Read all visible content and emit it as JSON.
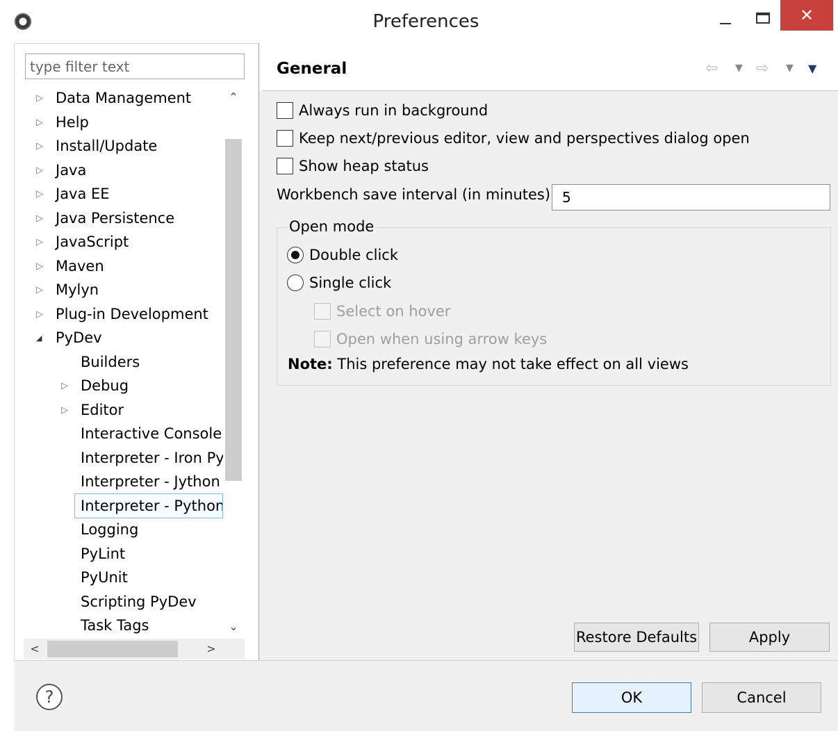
{
  "window": {
    "title": "Preferences",
    "close_glyph": "✕"
  },
  "sidebar": {
    "filter_placeholder": "type filter text",
    "items": [
      {
        "label": "Data Management",
        "level": 0,
        "twisty": "collapsed"
      },
      {
        "label": "Help",
        "level": 0,
        "twisty": "collapsed"
      },
      {
        "label": "Install/Update",
        "level": 0,
        "twisty": "collapsed"
      },
      {
        "label": "Java",
        "level": 0,
        "twisty": "collapsed"
      },
      {
        "label": "Java EE",
        "level": 0,
        "twisty": "collapsed"
      },
      {
        "label": "Java Persistence",
        "level": 0,
        "twisty": "collapsed"
      },
      {
        "label": "JavaScript",
        "level": 0,
        "twisty": "collapsed"
      },
      {
        "label": "Maven",
        "level": 0,
        "twisty": "collapsed"
      },
      {
        "label": "Mylyn",
        "level": 0,
        "twisty": "collapsed"
      },
      {
        "label": "Plug-in Development",
        "level": 0,
        "twisty": "collapsed"
      },
      {
        "label": "PyDev",
        "level": 0,
        "twisty": "expanded"
      },
      {
        "label": "Builders",
        "level": 1,
        "twisty": "none"
      },
      {
        "label": "Debug",
        "level": 1,
        "twisty": "collapsed"
      },
      {
        "label": "Editor",
        "level": 1,
        "twisty": "collapsed"
      },
      {
        "label": "Interactive Console",
        "level": 1,
        "twisty": "none"
      },
      {
        "label": "Interpreter - Iron Pyt",
        "level": 1,
        "twisty": "none"
      },
      {
        "label": "Interpreter - Jython",
        "level": 1,
        "twisty": "none"
      },
      {
        "label": "Interpreter - Python",
        "level": 1,
        "twisty": "none",
        "selected": true
      },
      {
        "label": "Logging",
        "level": 1,
        "twisty": "none"
      },
      {
        "label": "PyLint",
        "level": 1,
        "twisty": "none"
      },
      {
        "label": "PyUnit",
        "level": 1,
        "twisty": "none"
      },
      {
        "label": "Scripting PyDev",
        "level": 1,
        "twisty": "none"
      },
      {
        "label": "Task Tags",
        "level": 1,
        "twisty": "none"
      }
    ]
  },
  "page": {
    "title": "General",
    "options": [
      {
        "label": "Always run in background",
        "checked": false
      },
      {
        "label": "Keep next/previous editor, view and perspectives dialog open",
        "checked": false
      },
      {
        "label": "Show heap status",
        "checked": false
      }
    ],
    "interval_label": "Workbench save interval (in minutes):",
    "interval_value": "5",
    "open_mode": {
      "legend": "Open mode",
      "double_click": "Double click",
      "single_click": "Single click",
      "selected": "double_click",
      "select_on_hover": "Select on hover",
      "open_arrow_keys": "Open when using arrow keys",
      "note_bold": "Note:",
      "note_text": " This preference may not take effect on all views"
    },
    "restore_defaults": "Restore Defaults",
    "apply": "Apply"
  },
  "footer": {
    "help_glyph": "?",
    "ok": "OK",
    "cancel": "Cancel"
  }
}
